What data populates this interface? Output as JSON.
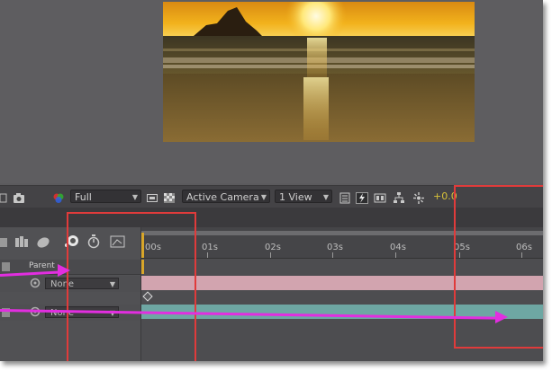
{
  "viewer_toolbar": {
    "resolution": "Full",
    "view": "Active Camera",
    "view_count": "1 View",
    "exposure": "+0.0"
  },
  "timeline": {
    "parent_header": "Parent",
    "ruler_ticks": [
      "00s",
      "01s",
      "02s",
      "03s",
      "04s",
      "05s",
      "06s"
    ],
    "layers": [
      {
        "parent": "None"
      },
      {
        "parent": "None"
      }
    ]
  },
  "colors": {
    "annotation_red": "#e03b3b",
    "annotation_magenta": "#e22ee0",
    "track_pink": "#d9a9b4",
    "track_teal": "#6ea7a3",
    "exposure_yellow": "#d8c23a"
  },
  "icons": [
    "camera-icon",
    "color-channels-icon",
    "transparency-grid-icon",
    "region-of-interest-icon",
    "fast-preview-icon",
    "flowchart-icon",
    "reset-exposure-icon",
    "stopwatch-icon"
  ]
}
